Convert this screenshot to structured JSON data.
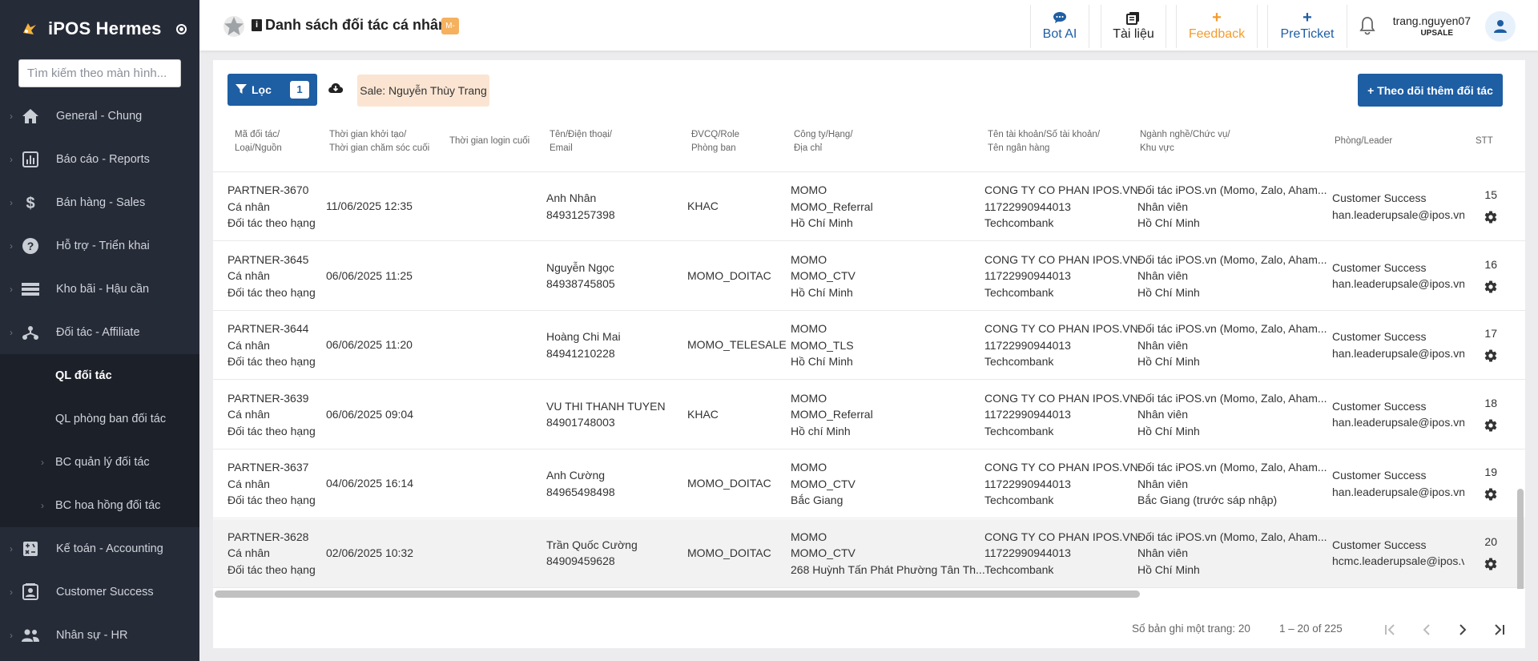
{
  "brand": {
    "name": "iPOS Hermes"
  },
  "sidebar": {
    "search_placeholder": "Tìm kiếm theo màn hình...",
    "items": [
      {
        "label": "General - Chung",
        "icon": "home-icon"
      },
      {
        "label": "Báo cáo - Reports",
        "icon": "bar-chart-icon"
      },
      {
        "label": "Bán hàng - Sales",
        "icon": "dollar-icon"
      },
      {
        "label": "Hỗ trợ - Triển khai",
        "icon": "help-icon"
      },
      {
        "label": "Kho bãi - Hậu cần",
        "icon": "list-icon"
      },
      {
        "label": "Đối tác - Affiliate",
        "icon": "affiliate-icon"
      },
      {
        "label": "QL đối tác",
        "sub": true,
        "active": true
      },
      {
        "label": "QL phòng ban đối tác",
        "sub": true
      },
      {
        "label": "BC quản lý đối tác",
        "sub": true,
        "chevron": true
      },
      {
        "label": "BC hoa hồng đối tác",
        "sub": true,
        "chevron": true
      },
      {
        "label": "Kế toán - Accounting",
        "icon": "accounting-icon"
      },
      {
        "label": "Customer Success",
        "icon": "contact-icon"
      },
      {
        "label": "Nhân sự - HR",
        "icon": "people-icon"
      }
    ]
  },
  "header": {
    "title": "Danh sách đối tác cá nhân",
    "badge": "M-",
    "buttons": [
      {
        "label": "Bot AI",
        "icon": "chat-icon",
        "color": "#1e5ea3"
      },
      {
        "label": "Tài liệu",
        "icon": "docs-icon",
        "color": "#222222"
      },
      {
        "label": "Feedback",
        "icon": "plus-icon",
        "color": "#f39c2e"
      },
      {
        "label": "PreTicket",
        "icon": "plus-icon",
        "color": "#1e5ea3"
      }
    ],
    "user": {
      "name": "trang.nguyen07",
      "role": "UPSALE"
    }
  },
  "toolbar": {
    "filter_label": "Lọc",
    "filter_count": "1",
    "sale_chip": "Sale: Nguyễn Thùy Trang",
    "follow_label": "+ Theo dõi thêm đối tác"
  },
  "table": {
    "headers": [
      [
        "Mã đối tác/",
        "Loại/Nguồn"
      ],
      [
        "Thời gian khởi tạo/",
        "Thời gian chăm sóc cuối"
      ],
      [
        "Thời gian login cuối"
      ],
      [
        "Tên/Điện thoại/",
        "Email"
      ],
      [
        "ĐVCQ/Role",
        "Phòng ban"
      ],
      [
        "Công ty/Hạng/",
        "Địa chỉ"
      ],
      [
        "Tên tài khoản/Số tài khoản/",
        "Tên ngân hàng"
      ],
      [
        "Ngành nghề/Chức vụ/",
        "Khu vực"
      ],
      [
        "Phòng/Leader"
      ],
      [
        "STT"
      ]
    ],
    "rows": [
      {
        "code": "PARTNER-3670",
        "type": "Cá nhân",
        "source": "Đối tác theo hạng",
        "created": "11/06/2025 12:35",
        "name": "Anh Nhân",
        "phone": "84931257398",
        "role": "KHAC",
        "company": "MOMO",
        "rank": "MOMO_Referral",
        "address": "Hồ Chí Minh",
        "acc_name": "CONG TY CO PHAN IPOS.VN",
        "acc_no": "11722990944013",
        "bank": "Techcombank",
        "industry": "Đối tác iPOS.vn (Momo, Zalo, Aham...",
        "position": "Nhân viên",
        "region": "Hồ Chí Minh",
        "dept": "Customer Success",
        "leader": "han.leaderupsale@ipos.vn",
        "stt": "15"
      },
      {
        "code": "PARTNER-3645",
        "type": "Cá nhân",
        "source": "Đối tác theo hạng",
        "created": "06/06/2025 11:25",
        "name": "Nguyễn Ngọc",
        "phone": "84938745805",
        "role": "MOMO_DOITAC",
        "company": "MOMO",
        "rank": "MOMO_CTV",
        "address": "Hồ Chí Minh",
        "acc_name": "CONG TY CO PHAN IPOS.VN",
        "acc_no": "11722990944013",
        "bank": "Techcombank",
        "industry": "Đối tác iPOS.vn (Momo, Zalo, Aham...",
        "position": "Nhân viên",
        "region": "Hồ Chí Minh",
        "dept": "Customer Success",
        "leader": "han.leaderupsale@ipos.vn",
        "stt": "16"
      },
      {
        "code": "PARTNER-3644",
        "type": "Cá nhân",
        "source": "Đối tác theo hạng",
        "created": "06/06/2025 11:20",
        "name": "Hoàng Chi Mai",
        "phone": "84941210228",
        "role": "MOMO_TELESALE",
        "company": "MOMO",
        "rank": "MOMO_TLS",
        "address": "Hồ Chí Minh",
        "acc_name": "CONG TY CO PHAN IPOS.VN",
        "acc_no": "11722990944013",
        "bank": "Techcombank",
        "industry": "Đối tác iPOS.vn (Momo, Zalo, Aham...",
        "position": "Nhân viên",
        "region": "Hồ Chí Minh",
        "dept": "Customer Success",
        "leader": "han.leaderupsale@ipos.vn",
        "stt": "17"
      },
      {
        "code": "PARTNER-3639",
        "type": "Cá nhân",
        "source": "Đối tác theo hạng",
        "created": "06/06/2025 09:04",
        "name": "VU THI THANH TUYEN",
        "phone": "84901748003",
        "role": "KHAC",
        "company": "MOMO",
        "rank": "MOMO_Referral",
        "address": "Hồ chí Minh",
        "acc_name": "CONG TY CO PHAN IPOS.VN",
        "acc_no": "11722990944013",
        "bank": "Techcombank",
        "industry": "Đối tác iPOS.vn (Momo, Zalo, Aham...",
        "position": "Nhân viên",
        "region": "Hồ Chí Minh",
        "dept": "Customer Success",
        "leader": "han.leaderupsale@ipos.vn",
        "stt": "18"
      },
      {
        "code": "PARTNER-3637",
        "type": "Cá nhân",
        "source": "Đối tác theo hạng",
        "created": "04/06/2025 16:14",
        "name": "Anh Cường",
        "phone": "84965498498",
        "role": "MOMO_DOITAC",
        "company": "MOMO",
        "rank": "MOMO_CTV",
        "address": "Bắc Giang",
        "acc_name": "CONG TY CO PHAN IPOS.VN",
        "acc_no": "11722990944013",
        "bank": "Techcombank",
        "industry": "Đối tác iPOS.vn (Momo, Zalo, Aham...",
        "position": "Nhân viên",
        "region": "Bắc Giang (trước sáp nhập)",
        "dept": "Customer Success",
        "leader": "han.leaderupsale@ipos.vn",
        "stt": "19"
      },
      {
        "code": "PARTNER-3628",
        "type": "Cá nhân",
        "source": "Đối tác theo hạng",
        "created": "02/06/2025 10:32",
        "name": "Trần Quốc Cường",
        "phone": "84909459628",
        "role": "MOMO_DOITAC",
        "company": "MOMO",
        "rank": "MOMO_CTV",
        "address": "268 Huỳnh Tấn Phát Phường Tân Th...",
        "acc_name": "CONG TY CO PHAN IPOS.VN",
        "acc_no": "11722990944013",
        "bank": "Techcombank",
        "industry": "Đối tác iPOS.vn (Momo, Zalo, Aham...",
        "position": "Nhân viên",
        "region": "Hồ Chí Minh",
        "dept": "Customer Success",
        "leader": "hcmc.leaderupsale@ipos.vn",
        "stt": "20"
      }
    ]
  },
  "pagination": {
    "per_page_label": "Số bản ghi một trang: 20",
    "range": "1 – 20 of 225"
  }
}
